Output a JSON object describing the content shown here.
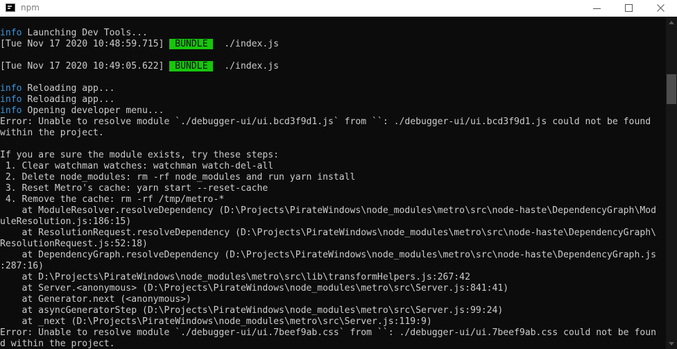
{
  "window": {
    "title": "npm",
    "icon": "terminal-icon",
    "buttons": [
      "minimize-icon",
      "maximize-icon",
      "close-icon"
    ]
  },
  "colors": {
    "background": "#0c0c0c",
    "text": "#cccccc",
    "info": "#3a96dd",
    "badge_background": "#16c60c"
  },
  "console": {
    "launching": {
      "level": "info",
      "text": " Launching Dev Tools..."
    },
    "bundle_1": {
      "prefix": "[Tue Nov 17 2020 10:48:59.715] ",
      "badge": " BUNDLE ",
      "suffix": "  ./index.js"
    },
    "bundle_2": {
      "prefix": "[Tue Nov 17 2020 10:49:05.622] ",
      "badge": " BUNDLE ",
      "suffix": "  ./index.js"
    },
    "reload_1": {
      "level": "info",
      "text": " Reloading app..."
    },
    "reload_2": {
      "level": "info",
      "text": " Reloading app..."
    },
    "dev_menu": {
      "level": "info",
      "text": " Opening developer menu..."
    },
    "text_lines": [
      "Error: Unable to resolve module `./debugger-ui/ui.bcd3f9d1.js` from ``: ./debugger-ui/ui.bcd3f9d1.js could not be found",
      "within the project.",
      "",
      "If you are sure the module exists, try these steps:",
      " 1. Clear watchman watches: watchman watch-del-all",
      " 2. Delete node_modules: rm -rf node_modules and run yarn install",
      " 3. Reset Metro's cache: yarn start --reset-cache",
      " 4. Remove the cache: rm -rf /tmp/metro-*",
      "    at ModuleResolver.resolveDependency (D:\\Projects\\PirateWindows\\node_modules\\metro\\src\\node-haste\\DependencyGraph\\Mod",
      "uleResolution.js:186:15)",
      "    at ResolutionRequest.resolveDependency (D:\\Projects\\PirateWindows\\node_modules\\metro\\src\\node-haste\\DependencyGraph\\",
      "ResolutionRequest.js:52:18)",
      "    at DependencyGraph.resolveDependency (D:\\Projects\\PirateWindows\\node_modules\\metro\\src\\node-haste\\DependencyGraph.js",
      ":287:16)",
      "    at D:\\Projects\\PirateWindows\\node_modules\\metro\\src\\lib\\transformHelpers.js:267:42",
      "    at Server.<anonymous> (D:\\Projects\\PirateWindows\\node_modules\\metro\\src\\Server.js:841:41)",
      "    at Generator.next (<anonymous>)",
      "    at asyncGeneratorStep (D:\\Projects\\PirateWindows\\node_modules\\metro\\src\\Server.js:99:24)",
      "    at _next (D:\\Projects\\PirateWindows\\node_modules\\metro\\src\\Server.js:119:9)",
      "Error: Unable to resolve module `./debugger-ui/ui.7beef9ab.css` from ``: ./debugger-ui/ui.7beef9ab.css could not be foun",
      "d within the project."
    ]
  }
}
